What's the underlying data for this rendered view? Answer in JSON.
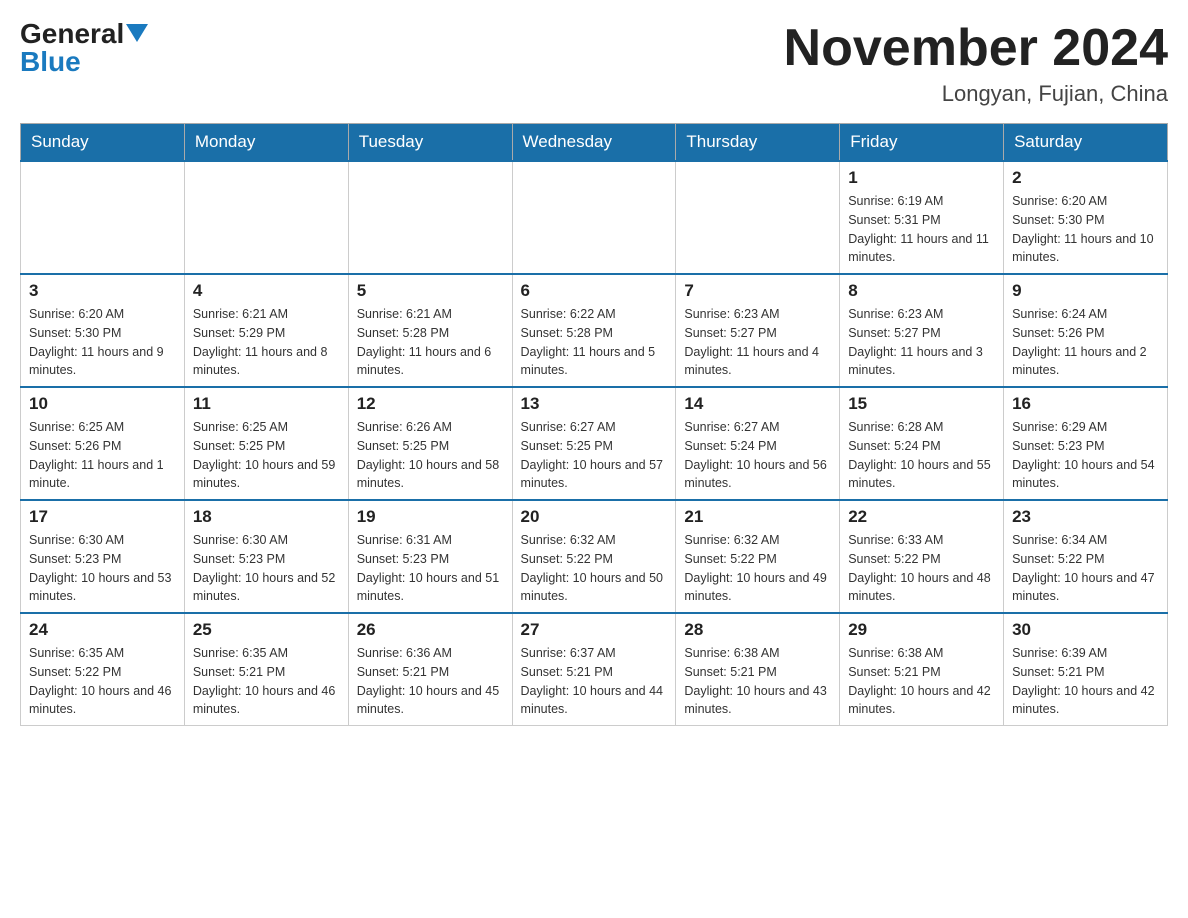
{
  "header": {
    "logo_general": "General",
    "logo_blue": "Blue",
    "title": "November 2024",
    "location": "Longyan, Fujian, China"
  },
  "weekdays": [
    "Sunday",
    "Monday",
    "Tuesday",
    "Wednesday",
    "Thursday",
    "Friday",
    "Saturday"
  ],
  "weeks": [
    [
      {
        "day": "",
        "info": ""
      },
      {
        "day": "",
        "info": ""
      },
      {
        "day": "",
        "info": ""
      },
      {
        "day": "",
        "info": ""
      },
      {
        "day": "",
        "info": ""
      },
      {
        "day": "1",
        "info": "Sunrise: 6:19 AM\nSunset: 5:31 PM\nDaylight: 11 hours and 11 minutes."
      },
      {
        "day": "2",
        "info": "Sunrise: 6:20 AM\nSunset: 5:30 PM\nDaylight: 11 hours and 10 minutes."
      }
    ],
    [
      {
        "day": "3",
        "info": "Sunrise: 6:20 AM\nSunset: 5:30 PM\nDaylight: 11 hours and 9 minutes."
      },
      {
        "day": "4",
        "info": "Sunrise: 6:21 AM\nSunset: 5:29 PM\nDaylight: 11 hours and 8 minutes."
      },
      {
        "day": "5",
        "info": "Sunrise: 6:21 AM\nSunset: 5:28 PM\nDaylight: 11 hours and 6 minutes."
      },
      {
        "day": "6",
        "info": "Sunrise: 6:22 AM\nSunset: 5:28 PM\nDaylight: 11 hours and 5 minutes."
      },
      {
        "day": "7",
        "info": "Sunrise: 6:23 AM\nSunset: 5:27 PM\nDaylight: 11 hours and 4 minutes."
      },
      {
        "day": "8",
        "info": "Sunrise: 6:23 AM\nSunset: 5:27 PM\nDaylight: 11 hours and 3 minutes."
      },
      {
        "day": "9",
        "info": "Sunrise: 6:24 AM\nSunset: 5:26 PM\nDaylight: 11 hours and 2 minutes."
      }
    ],
    [
      {
        "day": "10",
        "info": "Sunrise: 6:25 AM\nSunset: 5:26 PM\nDaylight: 11 hours and 1 minute."
      },
      {
        "day": "11",
        "info": "Sunrise: 6:25 AM\nSunset: 5:25 PM\nDaylight: 10 hours and 59 minutes."
      },
      {
        "day": "12",
        "info": "Sunrise: 6:26 AM\nSunset: 5:25 PM\nDaylight: 10 hours and 58 minutes."
      },
      {
        "day": "13",
        "info": "Sunrise: 6:27 AM\nSunset: 5:25 PM\nDaylight: 10 hours and 57 minutes."
      },
      {
        "day": "14",
        "info": "Sunrise: 6:27 AM\nSunset: 5:24 PM\nDaylight: 10 hours and 56 minutes."
      },
      {
        "day": "15",
        "info": "Sunrise: 6:28 AM\nSunset: 5:24 PM\nDaylight: 10 hours and 55 minutes."
      },
      {
        "day": "16",
        "info": "Sunrise: 6:29 AM\nSunset: 5:23 PM\nDaylight: 10 hours and 54 minutes."
      }
    ],
    [
      {
        "day": "17",
        "info": "Sunrise: 6:30 AM\nSunset: 5:23 PM\nDaylight: 10 hours and 53 minutes."
      },
      {
        "day": "18",
        "info": "Sunrise: 6:30 AM\nSunset: 5:23 PM\nDaylight: 10 hours and 52 minutes."
      },
      {
        "day": "19",
        "info": "Sunrise: 6:31 AM\nSunset: 5:23 PM\nDaylight: 10 hours and 51 minutes."
      },
      {
        "day": "20",
        "info": "Sunrise: 6:32 AM\nSunset: 5:22 PM\nDaylight: 10 hours and 50 minutes."
      },
      {
        "day": "21",
        "info": "Sunrise: 6:32 AM\nSunset: 5:22 PM\nDaylight: 10 hours and 49 minutes."
      },
      {
        "day": "22",
        "info": "Sunrise: 6:33 AM\nSunset: 5:22 PM\nDaylight: 10 hours and 48 minutes."
      },
      {
        "day": "23",
        "info": "Sunrise: 6:34 AM\nSunset: 5:22 PM\nDaylight: 10 hours and 47 minutes."
      }
    ],
    [
      {
        "day": "24",
        "info": "Sunrise: 6:35 AM\nSunset: 5:22 PM\nDaylight: 10 hours and 46 minutes."
      },
      {
        "day": "25",
        "info": "Sunrise: 6:35 AM\nSunset: 5:21 PM\nDaylight: 10 hours and 46 minutes."
      },
      {
        "day": "26",
        "info": "Sunrise: 6:36 AM\nSunset: 5:21 PM\nDaylight: 10 hours and 45 minutes."
      },
      {
        "day": "27",
        "info": "Sunrise: 6:37 AM\nSunset: 5:21 PM\nDaylight: 10 hours and 44 minutes."
      },
      {
        "day": "28",
        "info": "Sunrise: 6:38 AM\nSunset: 5:21 PM\nDaylight: 10 hours and 43 minutes."
      },
      {
        "day": "29",
        "info": "Sunrise: 6:38 AM\nSunset: 5:21 PM\nDaylight: 10 hours and 42 minutes."
      },
      {
        "day": "30",
        "info": "Sunrise: 6:39 AM\nSunset: 5:21 PM\nDaylight: 10 hours and 42 minutes."
      }
    ]
  ]
}
